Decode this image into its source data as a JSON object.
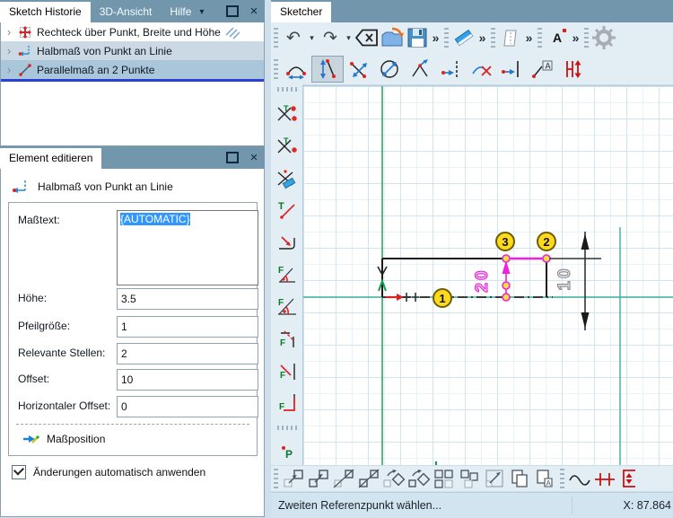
{
  "glyphs": {
    "expander": "›",
    "dropdown": "▾",
    "close": "×",
    "undo": "↶",
    "redo": "↷",
    "overflow": "»",
    "text_tool": "A"
  },
  "history_panel": {
    "tabs": [
      {
        "label": "Sketch Historie",
        "active": true
      },
      {
        "label": "3D-Ansicht",
        "active": false
      },
      {
        "label": "Hilfe",
        "active": false,
        "has_dropdown": true
      }
    ],
    "items": [
      {
        "label": "Rechteck über Punkt, Breite und Höhe",
        "icon": "rectangle-tool-icon",
        "trailing_icon": "hatch-icon",
        "selected": "none"
      },
      {
        "label": "Halbmaß von Punkt an Linie",
        "icon": "half-dimension-icon",
        "selected": "light"
      },
      {
        "label": "Parallelmaß an 2 Punkte",
        "icon": "parallel-dimension-icon",
        "selected": "strong"
      }
    ]
  },
  "editor_panel": {
    "tab_label": "Element editieren",
    "title": "Halbmaß von Punkt an Linie",
    "masstext_label": "Maßtext:",
    "masstext_value": "{AUTOMATIC}",
    "fields": [
      {
        "label": "Höhe:",
        "value": "3.5"
      },
      {
        "label": "Pfeilgröße:",
        "value": "1"
      },
      {
        "label": "Relevante Stellen:",
        "value": "2"
      },
      {
        "label": "Offset:",
        "value": "10"
      },
      {
        "label": "Horizontaler Offset:",
        "value": "0"
      }
    ],
    "massposition_label": "Maßposition",
    "checkbox_label": "Änderungen automatisch anwenden",
    "checkbox_checked": true
  },
  "sketcher": {
    "tab_label": "Sketcher",
    "toolbar_icons": {
      "main": [
        "undo",
        "undo-dropdown",
        "redo",
        "redo-dropdown",
        "backspace",
        "open-file",
        "save",
        "overflow",
        "eraser",
        "overflow",
        "panel",
        "overflow",
        "text-tool",
        "overflow",
        "settings-gear"
      ],
      "dimension": [
        "arc-dimension",
        "half-dimension-point-line",
        "parallel-dimension",
        "diameter-dimension",
        "angle-dimension",
        "point-to-line-dimension",
        "delete-arc-dimension",
        "line-to-line-dimension",
        "dimension-text",
        "height-dimension"
      ],
      "left": [
        "intersection-point",
        "intersection-point-2",
        "trim-delete",
        "tangent-line",
        "corner-fillet",
        "angle-constraint",
        "angle-constraint-2",
        "perpendicular-constraint",
        "distance-constraint",
        "right-angle-constraint",
        "point-tool"
      ],
      "bottom": [
        "move",
        "copy-move",
        "mirror",
        "mirror-copy",
        "rotate",
        "rotate-copy",
        "pattern-grid",
        "pattern-group",
        "scale",
        "copy-contour",
        "copy-with-text",
        "spline",
        "centerline-symbol",
        "frame-symbol"
      ]
    },
    "active_dimension_tool_index": 1,
    "status": {
      "message": "Zweiten Referenzpunkt wählen...",
      "coords": "X: 87.864"
    },
    "canvas": {
      "balloons": [
        {
          "n": "1"
        },
        {
          "n": "2"
        },
        {
          "n": "3"
        }
      ],
      "dims": {
        "magenta_value": "20",
        "gray_value": "10"
      },
      "colors": {
        "magenta": "#ee22dd",
        "axis_teal": "#3aaf9f",
        "axis_green": "#0f9d4e",
        "balloon_yellow": "#ffd91e",
        "dim_gray": "#8a8a8a"
      }
    }
  }
}
